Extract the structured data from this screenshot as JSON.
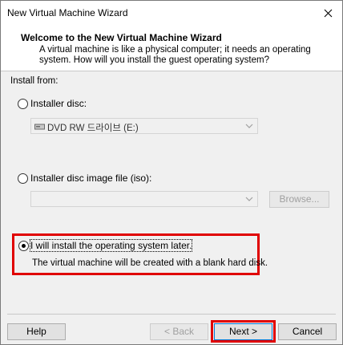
{
  "window": {
    "title": "New Virtual Machine Wizard"
  },
  "header": {
    "title": "Welcome to the New Virtual Machine Wizard",
    "description": "A virtual machine is like a physical computer; it needs an operating system. How will you install the guest operating system?"
  },
  "install": {
    "label": "Install from:",
    "options": [
      {
        "label": "Installer disc:",
        "selected": false
      },
      {
        "label": "Installer disc image file (iso):",
        "selected": false
      },
      {
        "label": "I will install the operating system later.",
        "selected": true
      }
    ],
    "disc_value": "DVD RW 드라이브 (E:)",
    "iso_value": "",
    "browse_label": "Browse...",
    "later_note": "The virtual machine will be created with a blank hard disk."
  },
  "footer": {
    "help": "Help",
    "back": "< Back",
    "next": "Next >",
    "cancel": "Cancel"
  },
  "colors": {
    "highlight": "#e00000",
    "background": "#f0f0f0"
  }
}
